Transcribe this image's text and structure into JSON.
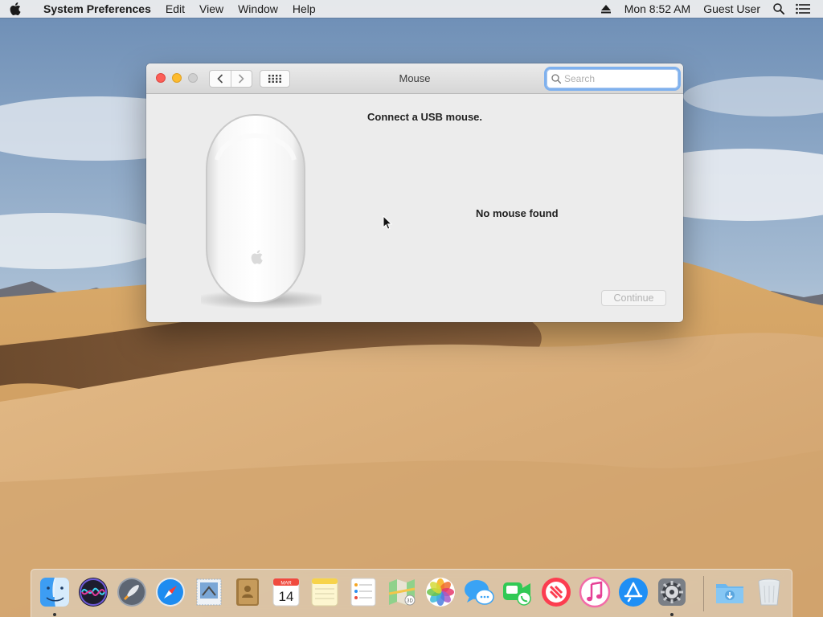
{
  "menubar": {
    "app_name": "System Preferences",
    "menus": [
      "Edit",
      "View",
      "Window",
      "Help"
    ],
    "time": "Mon 8:52 AM",
    "user": "Guest User"
  },
  "window": {
    "title": "Mouse",
    "search_placeholder": "Search",
    "heading": "Connect a USB mouse.",
    "status": "No mouse found",
    "continue_label": "Continue",
    "continue_enabled": false
  },
  "dock": {
    "apps": [
      {
        "name": "finder-icon",
        "running": true
      },
      {
        "name": "siri-icon",
        "running": false
      },
      {
        "name": "launchpad-icon",
        "running": false
      },
      {
        "name": "safari-icon",
        "running": false
      },
      {
        "name": "mail-icon",
        "running": false
      },
      {
        "name": "contacts-icon",
        "running": false
      },
      {
        "name": "calendar-icon",
        "running": false
      },
      {
        "name": "notes-icon",
        "running": false
      },
      {
        "name": "reminders-icon",
        "running": false
      },
      {
        "name": "maps-icon",
        "running": false
      },
      {
        "name": "photos-icon",
        "running": false
      },
      {
        "name": "messages-icon",
        "running": false
      },
      {
        "name": "facetime-icon",
        "running": false
      },
      {
        "name": "news-icon",
        "running": false
      },
      {
        "name": "itunes-icon",
        "running": false
      },
      {
        "name": "app-store-icon",
        "running": false
      },
      {
        "name": "system-preferences-icon",
        "running": true
      },
      {
        "name": "downloads-folder-icon",
        "running": false
      },
      {
        "name": "trash-icon",
        "running": false
      }
    ],
    "calendar_month": "MAR",
    "calendar_day": "14"
  },
  "colors": {
    "close": "#fc5f57",
    "minimize": "#fdbb2e",
    "focus_ring": "#7fb1ee"
  }
}
